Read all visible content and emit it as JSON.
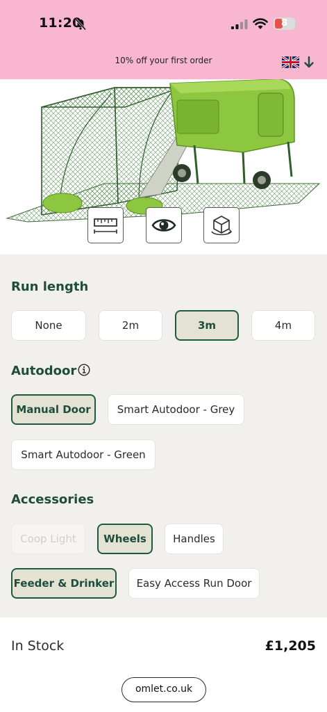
{
  "status_bar": {
    "time": "11:20",
    "battery_level": "8",
    "icons": [
      "bell-muted-icon",
      "cellular-signal-icon",
      "wifi-icon",
      "battery-icon"
    ]
  },
  "promo": {
    "text": "10% off your first order",
    "flag_icon": "uk-flag-icon",
    "arrow_icon": "arrow-down-icon"
  },
  "hero": {
    "image_desc_icon": "chicken-coop-product-image",
    "view_buttons": [
      "ruler-icon",
      "eye-icon",
      "cube-rotate-icon"
    ]
  },
  "run_length": {
    "title": "Run length",
    "options": [
      {
        "label": "None",
        "selected": false
      },
      {
        "label": "2m",
        "selected": false
      },
      {
        "label": "3m",
        "selected": true
      },
      {
        "label": "4m",
        "selected": false
      }
    ]
  },
  "autodoor": {
    "title": "Autodoor",
    "info_icon": "info-icon",
    "options": [
      {
        "label": "Manual Door",
        "selected": true
      },
      {
        "label": "Smart Autodoor - Grey",
        "selected": false
      },
      {
        "label": "Smart Autodoor - Green",
        "selected": false
      }
    ]
  },
  "accessories": {
    "title": "Accessories",
    "options": [
      {
        "label": "Coop Light",
        "selected": false,
        "disabled": true
      },
      {
        "label": "Wheels",
        "selected": true
      },
      {
        "label": "Handles",
        "selected": false
      },
      {
        "label": "Feeder & Drinker",
        "selected": true
      },
      {
        "label": "Easy Access Run Door",
        "selected": false
      }
    ]
  },
  "stock": {
    "label": "In Stock",
    "price": "£1,205"
  },
  "browser": {
    "url": "omlet.co.uk"
  },
  "colors": {
    "pink_band": "#f8b6cf",
    "brand_green": "#1f4d3c",
    "selected_fill": "#e4e2d3",
    "panel_bg": "#f1f0ec",
    "coop_green": "#8dc63f"
  }
}
